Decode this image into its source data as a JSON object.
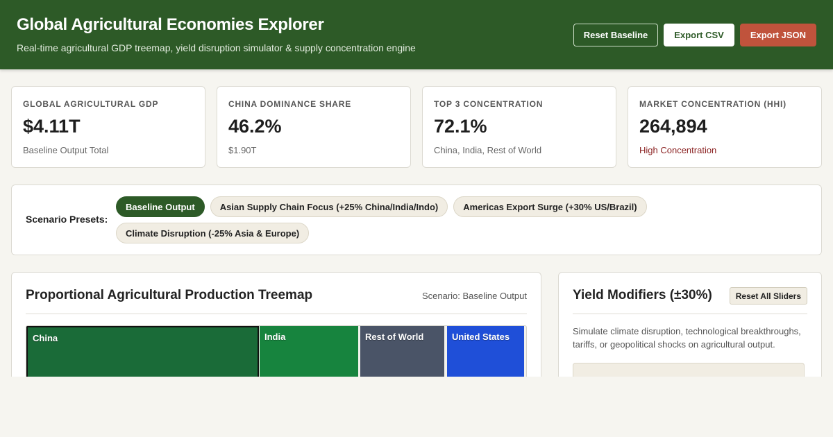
{
  "header": {
    "title": "Global Agricultural Economies Explorer",
    "subtitle": "Real-time agricultural GDP treemap, yield disruption simulator & supply concentration engine",
    "actions": {
      "reset": "Reset Baseline",
      "export_csv": "Export CSV",
      "export_json": "Export JSON"
    }
  },
  "kpis": [
    {
      "label": "GLOBAL AGRICULTURAL GDP",
      "value": "$4.11T",
      "sub": "Baseline Output Total"
    },
    {
      "label": "CHINA DOMINANCE SHARE",
      "value": "46.2%",
      "sub": "$1.90T"
    },
    {
      "label": "TOP 3 CONCENTRATION",
      "value": "72.1%",
      "sub": "China, India, Rest of World"
    },
    {
      "label": "MARKET CONCENTRATION (HHI)",
      "value": "264,894",
      "sub": "High Concentration"
    }
  ],
  "scenarios": {
    "label": "Scenario Presets:",
    "presets": [
      "Baseline Output",
      "Asian Supply Chain Focus (+25% China/India/Indo)",
      "Americas Export Surge (+30% US/Brazil)",
      "Climate Disruption (-25% Asia & Europe)"
    ],
    "active_index": 0
  },
  "treemap": {
    "title": "Proportional Agricultural Production Treemap",
    "scenario_tag": "Scenario: Baseline Output",
    "tiles": [
      {
        "name": "China",
        "color": "#1a6b38",
        "selected": true
      },
      {
        "name": "India",
        "color": "#17843e"
      },
      {
        "name": "Rest of World",
        "color": "#4a5467"
      },
      {
        "name": "United States",
        "color": "#1f4fd8"
      }
    ]
  },
  "yield": {
    "title": "Yield Modifiers (±30%)",
    "reset_label": "Reset All Sliders",
    "description": "Simulate climate disruption, technological breakthroughs, tariffs, or geopolitical shocks on agricultural output."
  },
  "colors": {
    "brand": "#2d5a27",
    "accent_red": "#c0533c",
    "alert_text": "#8b2323"
  }
}
